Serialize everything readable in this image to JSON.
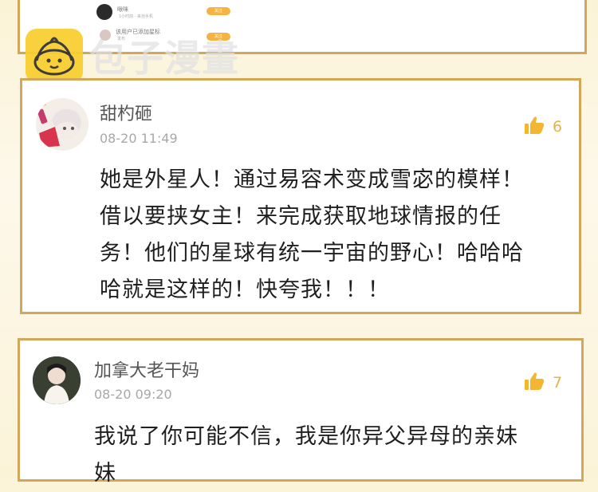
{
  "top_card": {
    "row1_name": "啾咪",
    "row1_sub": "1小时前 · 来自手机",
    "row1_button": "关注",
    "row2_text": "该用户已添加星标",
    "row2_sub": "发布",
    "row2_button": "关注"
  },
  "watermark": {
    "text": "包子漫畫",
    "logo_icon": "baozi-bun-icon"
  },
  "comments": [
    {
      "username": "甜杓砸",
      "timestamp": "08-20 11:49",
      "likes": "6",
      "lines": [
        "她是外星人！通过易容术变成雪宓的模样！",
        "借以要挟女主！来完成获取地球情报的任",
        "务！他们的星球有统一宇宙的野心！哈哈哈",
        "哈就是这样的！快夸我！！！"
      ]
    },
    {
      "username": "加拿大老干妈",
      "timestamp": "08-20 09:20",
      "likes": "7",
      "lines": [
        "我说了你可能不信，我是你异父异母的亲妹",
        "妹"
      ]
    }
  ],
  "colors": {
    "accent": "#d2a75a",
    "like": "#e9b247",
    "logo": "#f8cf32"
  }
}
